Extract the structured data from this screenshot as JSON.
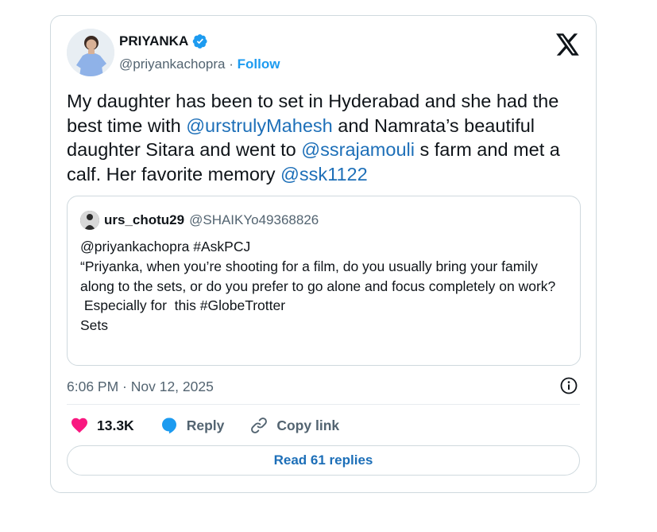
{
  "author": {
    "display_name": "PRIYANKA",
    "handle": "@priyankachopra",
    "separator": "·",
    "follow_label": "Follow"
  },
  "tweet": {
    "segments": [
      {
        "text": "My daughter has been to set in Hyderabad and she had the best time with ",
        "mention": false
      },
      {
        "text": "@urstrulyMahesh",
        "mention": true
      },
      {
        "text": " and Namrata’s beautiful daughter Sitara and went to ",
        "mention": false
      },
      {
        "text": "@ssrajamouli",
        "mention": true
      },
      {
        "text": " s farm and met a calf. Her favorite memory ",
        "mention": false
      },
      {
        "text": "@ssk1122",
        "mention": true
      }
    ]
  },
  "quote": {
    "display_name": "urs_chotu29",
    "handle": "@SHAIKYo49368826",
    "text": "@priyankachopra #AskPCJ\n“Priyanka, when you’re shooting for a film, do you usually bring your family along to the sets, or do you prefer to go alone and focus completely on work?\n Especially for  this #GlobeTrotter\nSets"
  },
  "meta": {
    "timestamp": "6:06 PM · Nov 12, 2025"
  },
  "actions": {
    "likes": "13.3K",
    "reply_label": "Reply",
    "copy_label": "Copy link"
  },
  "read_replies_label": "Read 61 replies",
  "colors": {
    "accent": "#1d9bf0",
    "link": "#1d6fb8",
    "heart": "#f91880",
    "muted": "#536471",
    "border": "#cfd9de"
  },
  "icons": [
    "verified-badge-icon",
    "x-logo-icon",
    "info-icon",
    "heart-icon",
    "reply-bubble-icon",
    "link-icon"
  ]
}
